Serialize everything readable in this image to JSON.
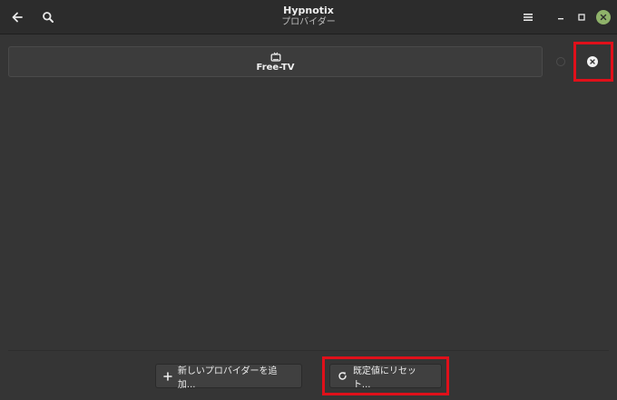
{
  "window": {
    "title": "Hypnotix",
    "subtitle": "プロバイダー"
  },
  "headerbar": {
    "back_icon": "back-arrow-icon",
    "search_icon": "search-icon",
    "menu_icon": "hamburger-menu-icon",
    "minimize_icon": "minimize-icon",
    "maximize_icon": "maximize-icon",
    "close_icon": "close-icon"
  },
  "providers": [
    {
      "name": "Free-TV",
      "icon": "tv-icon"
    }
  ],
  "buttons": {
    "add_provider": "新しいプロバイダーを追加...",
    "reset_defaults": "既定値にリセット..."
  },
  "colors": {
    "background": "#353535",
    "headerbar": "#2c2c2c",
    "close_button": "#8fb26a",
    "highlight": "#e0101a"
  }
}
